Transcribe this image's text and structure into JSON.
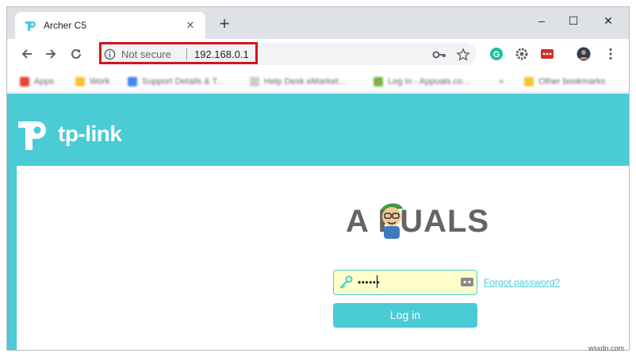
{
  "browser": {
    "tab": {
      "title": "Archer C5",
      "close": "✕"
    },
    "new_tab": "+",
    "window_controls": {
      "minimize": "–",
      "maximize": "☐",
      "close": "✕"
    },
    "address_bar": {
      "security_label": "Not secure",
      "url": "192.168.0.1"
    },
    "extensions": [
      "grammarly-icon",
      "gear-extension-icon",
      "lastpass-icon",
      "profile-avatar",
      "menu-icon"
    ]
  },
  "bookmarks": [
    "Apps",
    "Work",
    "Support Details & T...",
    "Help Desk eMarket...",
    "Log In - Appuals.co...",
    "",
    "Other bookmarks"
  ],
  "page": {
    "brand": "tp-link",
    "watermark": "A  PUALS",
    "login": {
      "password_masked": "••••••",
      "forgot_label": "Forgot password?",
      "button_label": "Log in"
    }
  },
  "footer_mark": "wsxdn.com",
  "colors": {
    "brand": "#4acbd6",
    "highlight": "#d3141c",
    "autofill": "#ffffcc"
  }
}
